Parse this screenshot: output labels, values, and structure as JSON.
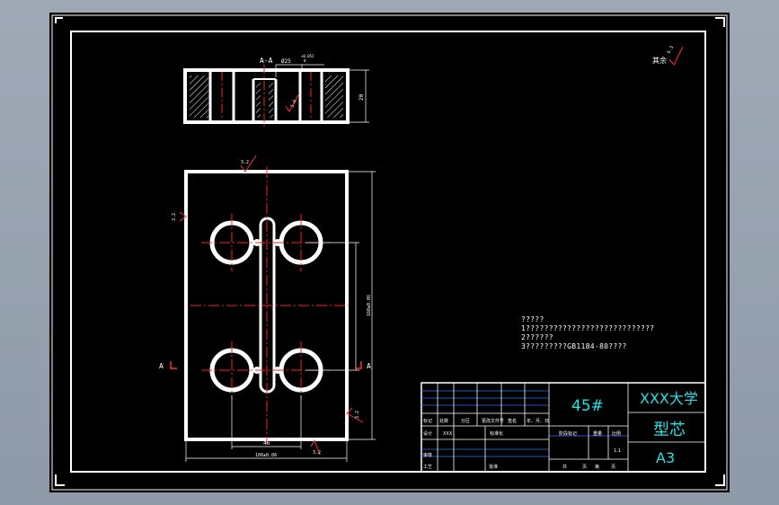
{
  "section_label": "A-A",
  "section_dims": {
    "bore_dia": "Ø25",
    "bore_tol_upper": "+0.052",
    "bore_tol_lower": "0",
    "thickness": "20",
    "wall_roughness": "1.6"
  },
  "plan_dims": {
    "top_roughness": "3.2",
    "left_roughness": "3.2",
    "right_roughness": "3.2",
    "bottom_roughness": "3.2",
    "hole_spacing": "46",
    "width": "100±0.06",
    "height": "160±0.06"
  },
  "section_markers": {
    "left": "A",
    "right": "A"
  },
  "general_roughness": {
    "value": "6.3",
    "label": "其余"
  },
  "notes": {
    "line1": "?????",
    "line2": "1????????????????????????????",
    "line3": "2??????",
    "line4": "3?????????GB1184-80????"
  },
  "title_block": {
    "material": "45#",
    "school": "XXX大学",
    "part_name": "型芯",
    "sheet_size": "A3",
    "scale": "1:1",
    "header_row": [
      "标记",
      "处数",
      "分区",
      "更改文件号",
      "签名",
      "年、月、日"
    ],
    "row_design": [
      "设计",
      "XXX",
      "标准化"
    ],
    "row_review": "审核",
    "row_process": "工艺",
    "row_approve": "批准",
    "stage_labels": [
      "阶段标记",
      "重量",
      "比例"
    ],
    "sheet_info": [
      "共",
      "页",
      "第",
      "页"
    ]
  }
}
